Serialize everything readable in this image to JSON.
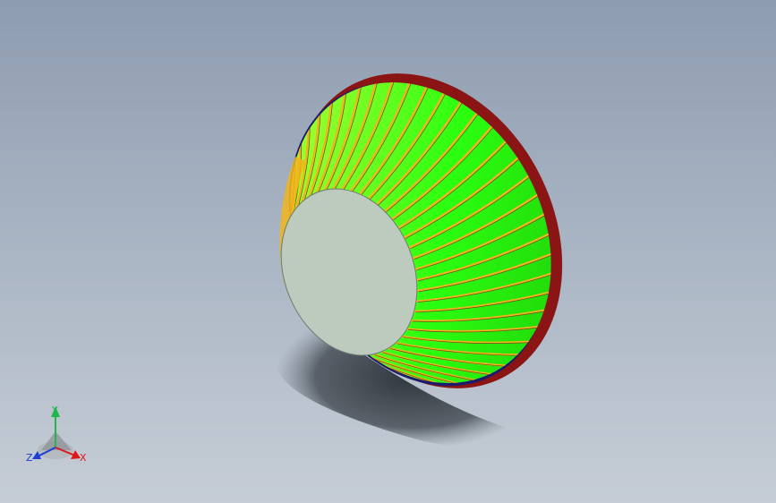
{
  "triad": {
    "x_label": "X",
    "y_label": "Y",
    "z_label": "Z",
    "x_color": "#e0161b",
    "y_color": "#21b64a",
    "z_color": "#1d3fd6"
  },
  "part": {
    "rim_outer_color": "#8b1414",
    "rim_inner_color": "#1a1a6e",
    "fin_color": "#2bff10",
    "fin_edge_color": "#f2b51b",
    "base_face_color": "#bccbbe"
  }
}
